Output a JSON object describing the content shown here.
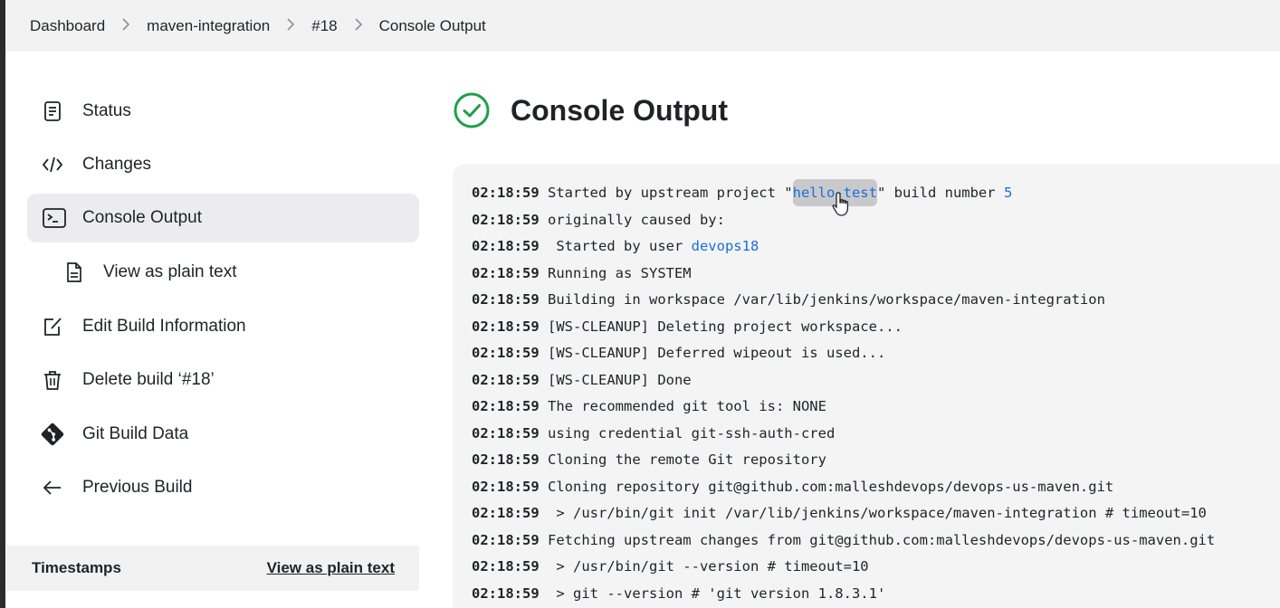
{
  "breadcrumb": {
    "items": [
      "Dashboard",
      "maven-integration",
      "#18",
      "Console Output"
    ],
    "separator": ">"
  },
  "sidebar": {
    "items": [
      {
        "label": "Status",
        "icon": "document-icon"
      },
      {
        "label": "Changes",
        "icon": "code-icon"
      },
      {
        "label": "Console Output",
        "icon": "terminal-icon",
        "active": true
      },
      {
        "label": "View as plain text",
        "icon": "file-text-icon",
        "sub": true
      },
      {
        "label": "Edit Build Information",
        "icon": "edit-icon"
      },
      {
        "label": "Delete build ‘#18’",
        "icon": "trash-icon"
      },
      {
        "label": "Git Build Data",
        "icon": "git-icon"
      },
      {
        "label": "Previous Build",
        "icon": "arrow-left-icon"
      }
    ]
  },
  "timestamps": {
    "title": "Timestamps",
    "link": "View as plain text"
  },
  "main": {
    "title": "Console Output",
    "status_icon": "success-check-icon",
    "accent_color": "#1ea04a"
  },
  "console": {
    "lines": [
      {
        "time": "02:18:59",
        "text": "Started by upstream project \"",
        "link": "hello-test",
        "text2": "\" build number ",
        "link2": "5"
      },
      {
        "time": "02:18:59",
        "text": "originally caused by:"
      },
      {
        "time": "02:18:59",
        "text": " Started by user ",
        "link": "devops18"
      },
      {
        "time": "02:18:59",
        "text": "Running as SYSTEM"
      },
      {
        "time": "02:18:59",
        "text": "Building in workspace /var/lib/jenkins/workspace/maven-integration"
      },
      {
        "time": "02:18:59",
        "text": "[WS-CLEANUP] Deleting project workspace..."
      },
      {
        "time": "02:18:59",
        "text": "[WS-CLEANUP] Deferred wipeout is used..."
      },
      {
        "time": "02:18:59",
        "text": "[WS-CLEANUP] Done"
      },
      {
        "time": "02:18:59",
        "text": "The recommended git tool is: NONE"
      },
      {
        "time": "02:18:59",
        "text": "using credential git-ssh-auth-cred"
      },
      {
        "time": "02:18:59",
        "text": "Cloning the remote Git repository"
      },
      {
        "time": "02:18:59",
        "text": "Cloning repository git@github.com:malleshdevops/devops-us-maven.git"
      },
      {
        "time": "02:18:59",
        "text": " > /usr/bin/git init /var/lib/jenkins/workspace/maven-integration # timeout=10"
      },
      {
        "time": "02:18:59",
        "text": "Fetching upstream changes from git@github.com:malleshdevops/devops-us-maven.git"
      },
      {
        "time": "02:18:59",
        "text": " > /usr/bin/git --version # timeout=10"
      },
      {
        "time": "02:18:59",
        "text": " > git --version # 'git version 1.8.3.1'"
      }
    ],
    "link_color": "#1a6fd6"
  }
}
